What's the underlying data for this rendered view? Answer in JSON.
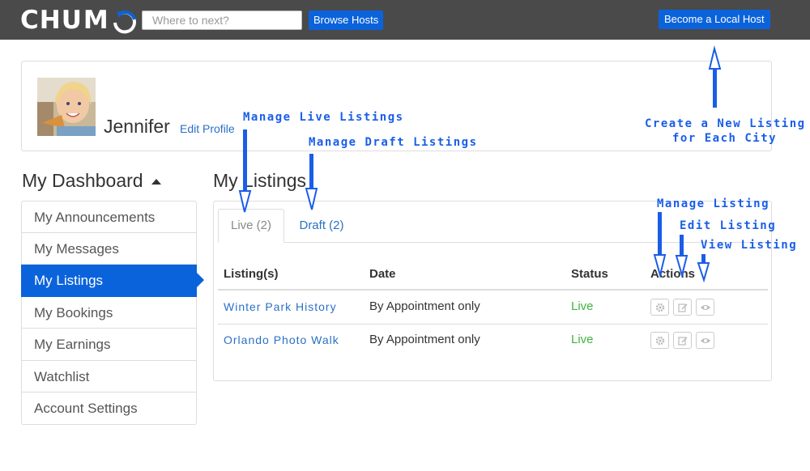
{
  "header": {
    "logo_text": "CHUMO",
    "logo_letters": "CHU",
    "search_placeholder": "Where to next?",
    "browse_hosts_label": "Browse Hosts",
    "become_host_label": "Become a Local Host"
  },
  "profile": {
    "name": "Jennifer",
    "edit_label": "Edit Profile"
  },
  "dashboard": {
    "title": "My Dashboard",
    "items": [
      {
        "label": "My Announcements",
        "active": false
      },
      {
        "label": "My Messages",
        "active": false
      },
      {
        "label": "My Listings",
        "active": true
      },
      {
        "label": "My Bookings",
        "active": false
      },
      {
        "label": "My Earnings",
        "active": false
      },
      {
        "label": "Watchlist",
        "active": false
      },
      {
        "label": "Account Settings",
        "active": false
      }
    ]
  },
  "listings": {
    "title": "My Listings",
    "tabs": [
      {
        "label": "Live (2)",
        "active": true
      },
      {
        "label": "Draft (2)",
        "active": false
      }
    ],
    "columns": [
      "Listing(s)",
      "Date",
      "Status",
      "Actions"
    ],
    "rows": [
      {
        "title": "Winter Park History",
        "date": "By Appointment only",
        "status": "Live"
      },
      {
        "title": "Orlando Photo Walk",
        "date": "By Appointment only",
        "status": "Live"
      }
    ],
    "action_icons": [
      "gear-icon",
      "edit-icon",
      "eye-icon"
    ]
  },
  "annotations": {
    "manage_live": "Manage Live Listings",
    "manage_draft": "Manage Draft Listings",
    "create_line1": "Create a New Listing",
    "create_line2": "for Each City",
    "manage_listing": "Manage Listing",
    "edit_listing": "Edit Listing",
    "view_listing": "View Listing"
  },
  "colors": {
    "topbar": "#4a4a4a",
    "accent": "#0b63db",
    "link": "#2a70c6",
    "live": "#3db53d",
    "annotation": "#1a5ee8"
  }
}
